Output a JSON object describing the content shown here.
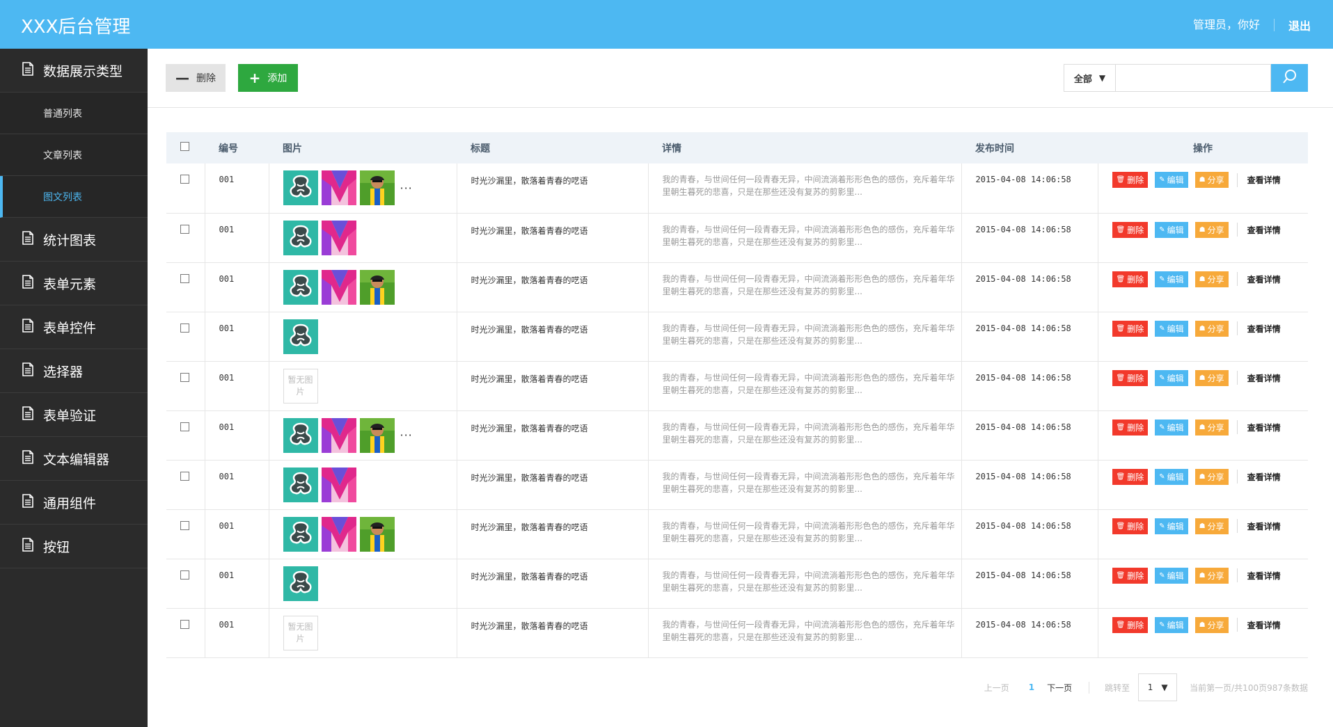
{
  "header": {
    "brand": "XXX后台管理",
    "greeting": "管理员，你好",
    "logout": "退出",
    "bg_color": "#4db8f2"
  },
  "sidebar": {
    "items": [
      {
        "label": "数据展示类型",
        "icon": "document-icon"
      },
      {
        "label": "统计图表",
        "icon": "document-icon"
      },
      {
        "label": "表单元素",
        "icon": "document-icon"
      },
      {
        "label": "表单控件",
        "icon": "document-icon"
      },
      {
        "label": "选择器",
        "icon": "document-icon"
      },
      {
        "label": "表单验证",
        "icon": "document-icon"
      },
      {
        "label": "文本编辑器",
        "icon": "document-icon"
      },
      {
        "label": "通用组件",
        "icon": "document-icon"
      },
      {
        "label": "按钮",
        "icon": "document-icon"
      }
    ],
    "subitems": [
      {
        "label": "普通列表"
      },
      {
        "label": "文章列表"
      },
      {
        "label": "图文列表",
        "active": true
      }
    ]
  },
  "toolbar": {
    "delete_label": "删除",
    "add_label": "添加",
    "filter_value": "全部",
    "search_value": "",
    "search_placeholder": ""
  },
  "table": {
    "headers": [
      "编号",
      "图片",
      "标题",
      "详情",
      "发布时间",
      "操作"
    ],
    "ops": {
      "delete": "删除",
      "edit": "编辑",
      "share": "分享",
      "view": "查看详情"
    },
    "no_image_text": "暂无图片",
    "more_text": "···",
    "rows": [
      {
        "id": "001",
        "images": [
          "teal",
          "pink",
          "grass"
        ],
        "more": true,
        "title": "时光沙漏里，散落着青春的呓语",
        "detail": "我的青春，与世间任何一段青春无异，中间流淌着形形色色的感伤，充斥着年华里朝生暮死的悲喜，只是在那些还没有复苏的剪影里...",
        "date": "2015-04-08 14:06:58"
      },
      {
        "id": "001",
        "images": [
          "teal",
          "pink"
        ],
        "more": false,
        "title": "时光沙漏里，散落着青春的呓语",
        "detail": "我的青春，与世间任何一段青春无异，中间流淌着形形色色的感伤，充斥着年华里朝生暮死的悲喜，只是在那些还没有复苏的剪影里...",
        "date": "2015-04-08 14:06:58"
      },
      {
        "id": "001",
        "images": [
          "teal",
          "pink",
          "grass"
        ],
        "more": false,
        "title": "时光沙漏里，散落着青春的呓语",
        "detail": "我的青春，与世间任何一段青春无异，中间流淌着形形色色的感伤，充斥着年华里朝生暮死的悲喜，只是在那些还没有复苏的剪影里...",
        "date": "2015-04-08 14:06:58"
      },
      {
        "id": "001",
        "images": [
          "teal"
        ],
        "more": false,
        "title": "时光沙漏里，散落着青春的呓语",
        "detail": "我的青春，与世间任何一段青春无异，中间流淌着形形色色的感伤，充斥着年华里朝生暮死的悲喜，只是在那些还没有复苏的剪影里...",
        "date": "2015-04-08 14:06:58"
      },
      {
        "id": "001",
        "images": [],
        "more": false,
        "title": "时光沙漏里，散落着青春的呓语",
        "detail": "我的青春，与世间任何一段青春无异，中间流淌着形形色色的感伤，充斥着年华里朝生暮死的悲喜，只是在那些还没有复苏的剪影里...",
        "date": "2015-04-08 14:06:58"
      },
      {
        "id": "001",
        "images": [
          "teal",
          "pink",
          "grass"
        ],
        "more": true,
        "title": "时光沙漏里，散落着青春的呓语",
        "detail": "我的青春，与世间任何一段青春无异，中间流淌着形形色色的感伤，充斥着年华里朝生暮死的悲喜，只是在那些还没有复苏的剪影里...",
        "date": "2015-04-08 14:06:58"
      },
      {
        "id": "001",
        "images": [
          "teal",
          "pink"
        ],
        "more": false,
        "title": "时光沙漏里，散落着青春的呓语",
        "detail": "我的青春，与世间任何一段青春无异，中间流淌着形形色色的感伤，充斥着年华里朝生暮死的悲喜，只是在那些还没有复苏的剪影里...",
        "date": "2015-04-08 14:06:58"
      },
      {
        "id": "001",
        "images": [
          "teal",
          "pink",
          "grass"
        ],
        "more": false,
        "title": "时光沙漏里，散落着青春的呓语",
        "detail": "我的青春，与世间任何一段青春无异，中间流淌着形形色色的感伤，充斥着年华里朝生暮死的悲喜，只是在那些还没有复苏的剪影里...",
        "date": "2015-04-08 14:06:58"
      },
      {
        "id": "001",
        "images": [
          "teal"
        ],
        "more": false,
        "title": "时光沙漏里，散落着青春的呓语",
        "detail": "我的青春，与世间任何一段青春无异，中间流淌着形形色色的感伤，充斥着年华里朝生暮死的悲喜，只是在那些还没有复苏的剪影里...",
        "date": "2015-04-08 14:06:58"
      },
      {
        "id": "001",
        "images": [],
        "more": false,
        "title": "时光沙漏里，散落着青春的呓语",
        "detail": "我的青春，与世间任何一段青春无异，中间流淌着形形色色的感伤，充斥着年华里朝生暮死的悲喜，只是在那些还没有复苏的剪影里...",
        "date": "2015-04-08 14:06:58"
      }
    ]
  },
  "pager": {
    "prev": "上一页",
    "current": "1",
    "next": "下一页",
    "jump_label": "跳转至",
    "jump_value": "1",
    "info": "当前第一页/共100页987条数据"
  },
  "colors": {
    "accent": "#4db8f2",
    "add": "#2ea83f",
    "danger": "#f2392b",
    "warning": "#f7a93a",
    "sidebar": "#2b2b2b"
  }
}
